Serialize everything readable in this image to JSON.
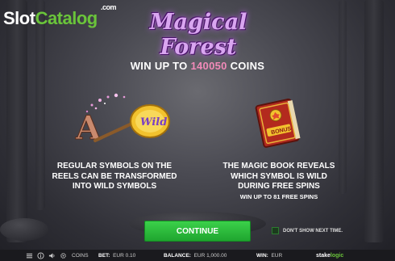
{
  "watermark": {
    "brand_a": "Slot",
    "brand_b": "Catalog",
    "com": ".com"
  },
  "game": {
    "title": "Magical Forest"
  },
  "headline": {
    "prefix": "WIN UP TO ",
    "amount": "140050",
    "suffix": " COINS"
  },
  "features": {
    "left": {
      "icon": "wild-wand-icon",
      "icon_text": "Wild",
      "letter": "A",
      "lines": [
        "REGULAR SYMBOLS ON THE",
        "REELS CAN BE TRANSFORMED",
        "INTO WILD SYMBOLS"
      ]
    },
    "right": {
      "icon": "magic-book-icon",
      "icon_text": "BONUS",
      "lines": [
        "THE MAGIC BOOK REVEALS",
        "WHICH SYMBOL IS WILD",
        "DURING FREE SPINS"
      ],
      "sub": "WIN UP TO 81 FREE SPINS"
    }
  },
  "actions": {
    "continue_label": "CONTINUE",
    "dont_show_label": "DON'T SHOW NEXT TIME."
  },
  "bottom_bar": {
    "icons": [
      "menu-icon",
      "sound-icon",
      "settings-icon"
    ],
    "coins_label": "COINS",
    "bet_label": "BET:",
    "bet_value": "EUR 0.10",
    "balance_label": "BALANCE:",
    "balance_value": "EUR 1,000.00",
    "win_label": "WIN:",
    "win_value": "EUR",
    "provider_a": "stake",
    "provider_b": "logic"
  },
  "colors": {
    "accent_green": "#1fa52f",
    "highlight_pink": "#f08ab8",
    "title_purple": "#d9a6f0"
  }
}
